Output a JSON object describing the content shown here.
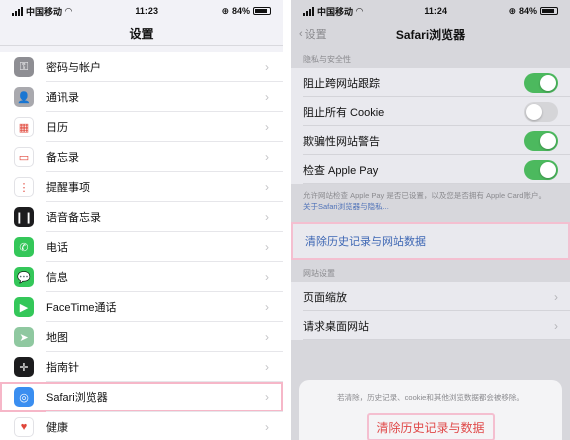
{
  "left": {
    "status": {
      "carrier": "中国移动",
      "time": "11:23",
      "battery": "84%"
    },
    "title": "设置",
    "items": [
      {
        "label": "密码与帐户",
        "icon": "key-icon",
        "color": "#8e8e93",
        "glyph": "⚿"
      },
      {
        "label": "通讯录",
        "icon": "contacts-icon",
        "color": "#a9a9ae",
        "glyph": "👤"
      },
      {
        "label": "日历",
        "icon": "calendar-icon",
        "color": "#ffffff",
        "glyph": "▦"
      },
      {
        "label": "备忘录",
        "icon": "notes-icon",
        "color": "#ffffff",
        "glyph": "▭"
      },
      {
        "label": "提醒事项",
        "icon": "reminders-icon",
        "color": "#ffffff",
        "glyph": "⋮"
      },
      {
        "label": "语音备忘录",
        "icon": "voice-memos-icon",
        "color": "#1c1c1e",
        "glyph": "❙❙"
      },
      {
        "label": "电话",
        "icon": "phone-icon",
        "color": "#34c759",
        "glyph": "✆"
      },
      {
        "label": "信息",
        "icon": "messages-icon",
        "color": "#34c759",
        "glyph": "💬"
      },
      {
        "label": "FaceTime通话",
        "icon": "facetime-icon",
        "color": "#34c759",
        "glyph": "▶"
      },
      {
        "label": "地图",
        "icon": "maps-icon",
        "color": "#8fc8a0",
        "glyph": "➤"
      },
      {
        "label": "指南针",
        "icon": "compass-icon",
        "color": "#1c1c1e",
        "glyph": "✛"
      },
      {
        "label": "Safari浏览器",
        "icon": "safari-icon",
        "color": "#3a8ef0",
        "glyph": "◎"
      },
      {
        "label": "健康",
        "icon": "health-icon",
        "color": "#ffffff",
        "glyph": "♥"
      }
    ]
  },
  "right": {
    "status": {
      "carrier": "中国移动",
      "time": "11:24",
      "battery": "84%"
    },
    "back_label": "设置",
    "title": "Safari浏览器",
    "privacy_header": "隐私与安全性",
    "toggles": [
      {
        "label": "阻止跨网站跟踪",
        "on": true
      },
      {
        "label": "阻止所有 Cookie",
        "on": false
      },
      {
        "label": "欺骗性网站警告",
        "on": true
      },
      {
        "label": "检查 Apple Pay",
        "on": true
      }
    ],
    "footnote": "允许网站检查 Apple Pay 是否已设置，以及您是否拥有 Apple Card账户。",
    "footnote_link": "关于Safari浏览器与隐私...",
    "clear_label": "清除历史记录与网站数据",
    "website_header": "网站设置",
    "website_items": [
      "页面缩放",
      "请求桌面网站"
    ],
    "sheet_message": "若清除，历史记录、cookie和其他浏览数据都会被移除。",
    "sheet_button": "清除历史记录与数据"
  },
  "colors": {
    "toggle_on": "#4cb95e",
    "link": "#3e67b4",
    "destructive": "#e04848",
    "highlight": "#f4bfd0"
  }
}
